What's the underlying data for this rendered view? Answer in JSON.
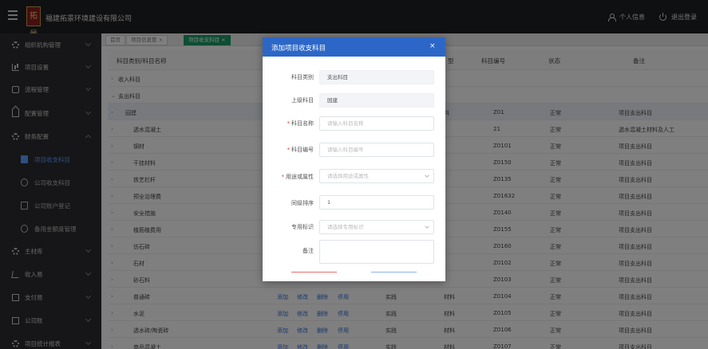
{
  "header": {
    "logo_text": "拓景",
    "company": "福建拓景环境建设有限公司",
    "user": "个人信息",
    "logout": "退出登录"
  },
  "sidebar": {
    "items": [
      {
        "label": "组织机构管理",
        "icon": "org-icon"
      },
      {
        "label": "项目设置",
        "icon": "chart-icon"
      },
      {
        "label": "流程管理",
        "icon": "flow-icon"
      },
      {
        "label": "配置管理",
        "icon": "home-icon"
      },
      {
        "label": "财务配置",
        "icon": "gear-icon"
      },
      {
        "label": "主材库",
        "icon": "gear-icon"
      },
      {
        "label": "收入易",
        "icon": "cart-icon"
      },
      {
        "label": "支付易",
        "icon": "doc-icon"
      },
      {
        "label": "公司账",
        "icon": "doc-icon"
      },
      {
        "label": "项目统计报表",
        "icon": "gear-icon"
      }
    ],
    "sub_items": [
      {
        "label": "项目收支科目",
        "icon": "doc-icon"
      },
      {
        "label": "公司收支科目",
        "icon": "gear-icon"
      },
      {
        "label": "公司账户登记",
        "icon": "doc-icon"
      },
      {
        "label": "备用金额度管理",
        "icon": "clock-icon"
      }
    ]
  },
  "tabs": [
    {
      "label": "首页"
    },
    {
      "label": "项目信息管 ×"
    },
    {
      "label": "项目收支科目 ×"
    }
  ],
  "table": {
    "headers": {
      "name": "科目类别/科目名称",
      "type": "型",
      "code": "科目编号",
      "status": "状态",
      "remark": "备注"
    },
    "groups": [
      "收入科目",
      "支出科目"
    ],
    "rows": [
      {
        "name": "园建",
        "type": "料",
        "code": "Z01",
        "status": "正常",
        "remark": "项目支出科目"
      },
      {
        "name": "透水混凝土",
        "type": "",
        "code": "21",
        "status": "正常",
        "remark": "透水混凝土材料及人工"
      },
      {
        "name": "钢材",
        "type": "",
        "code": "Z0101",
        "status": "正常",
        "remark": "项目支出科目"
      },
      {
        "name": "干挂材料",
        "type": "",
        "code": "Z0150",
        "status": "正常",
        "remark": "项目支出科目"
      },
      {
        "name": "铁艺栏杆",
        "type": "",
        "code": "Z0135",
        "status": "正常",
        "remark": "项目支出科目"
      },
      {
        "name": "预全治理费",
        "type": "",
        "code": "Z01632",
        "status": "正常",
        "remark": "项目支出科目"
      },
      {
        "name": "安全措施",
        "type": "",
        "code": "Z0140",
        "status": "正常",
        "remark": "项目支出科目"
      },
      {
        "name": "植筋植费用",
        "type": "",
        "code": "Z0155",
        "status": "正常",
        "remark": "项目支出科目"
      },
      {
        "name": "仿石砖",
        "type": "",
        "code": "Z0160",
        "status": "正常",
        "remark": "项目支出科目"
      },
      {
        "name": "石材",
        "type": "",
        "code": "Z0102",
        "status": "正常",
        "remark": "项目支出科目"
      },
      {
        "name": "砂石料",
        "type": "",
        "code": "Z0103",
        "status": "正常",
        "remark": "项目支出科目"
      },
      {
        "name": "普通砖",
        "type": "材料",
        "code": "Z0104",
        "status": "正常",
        "remark": "项目支出科目"
      },
      {
        "name": "水泥",
        "type": "材料",
        "code": "Z0105",
        "status": "正常",
        "remark": "项目支出科目"
      },
      {
        "name": "透水砖/陶瓷砖",
        "type": "材料",
        "code": "Z0106",
        "status": "正常",
        "remark": "项目支出科目"
      },
      {
        "name": "商品混凝土",
        "type": "材料",
        "code": "Z0107",
        "status": "正常",
        "remark": "项目支出科目"
      }
    ],
    "row_ops": {
      "add": "添加",
      "edit": "修改",
      "delete": "删除",
      "disable": "停用",
      "practice": "实践"
    }
  },
  "modal": {
    "title": "添加项目收支科目",
    "close": "×",
    "fields": {
      "category": {
        "label": "科目类别",
        "value": "支出科目"
      },
      "parent": {
        "label": "上级科目",
        "value": "园建"
      },
      "name": {
        "label": "科目名称",
        "placeholder": "请输入科目名称"
      },
      "code": {
        "label": "科目编号",
        "placeholder": "请输入科目编号"
      },
      "usage": {
        "label": "用途或属性",
        "placeholder": "请选择用途或属性"
      },
      "order": {
        "label": "同级排序",
        "value": "1"
      },
      "tag": {
        "label": "专用标识",
        "placeholder": "请选择专用标识"
      },
      "remark": {
        "label": "备注"
      }
    }
  },
  "colors": {
    "topbar": "#1f2023",
    "sidebar": "#2c2d30",
    "modal_header": "#2c67c8",
    "active_tab": "#1a9c66",
    "link": "#2f6fd6"
  }
}
